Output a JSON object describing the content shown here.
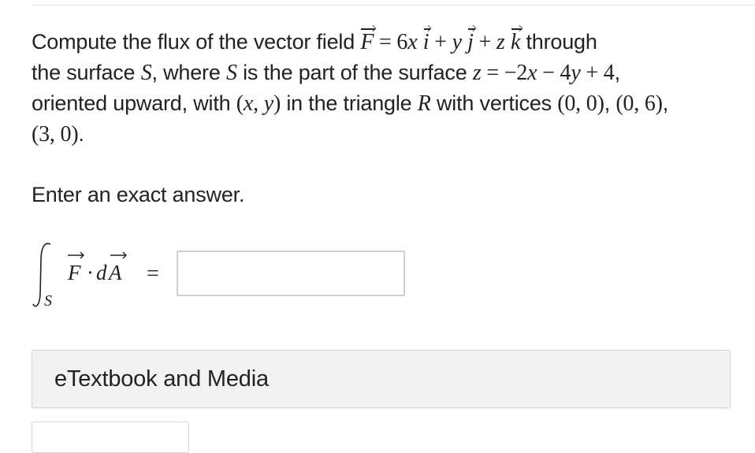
{
  "question": {
    "t1": "Compute the flux of the vector field ",
    "F": "F",
    "eq": " = 6",
    "x1": "x",
    "i": "i",
    "plus1": " + ",
    "y1": "y",
    "j": "j",
    "plus2": " + ",
    "z1": "z",
    "k": "k",
    "t2": " through",
    "t3": "the surface ",
    "S1": "S",
    "t4": ", where ",
    "S2": "S",
    "t5": " is the part of the surface ",
    "z2": "z",
    "eq2": " = −2",
    "x2": "x",
    "minus": " − 4",
    "y2": "y",
    "plus4": " + 4",
    "t6": ",",
    "t7": "oriented upward, with ",
    "paren_open": "(",
    "x3": "x",
    "comma": ", ",
    "y3": "y",
    "paren_close": ")",
    "t8": " in the triangle ",
    "R": "R",
    "t9": " with vertices ",
    "v1": "(0, 0)",
    "sep1": ", ",
    "v2": "(0, 6)",
    "sep2": ",",
    "v3": "(3, 0)",
    "end": "."
  },
  "prompt": "Enter an exact answer.",
  "integral": {
    "sub": "S",
    "F": "F",
    "dot": "·",
    "d": "d",
    "A": "A",
    "eq": "="
  },
  "answer": {
    "value": "",
    "placeholder": ""
  },
  "media_panel": {
    "label": "eTextbook and Media"
  }
}
